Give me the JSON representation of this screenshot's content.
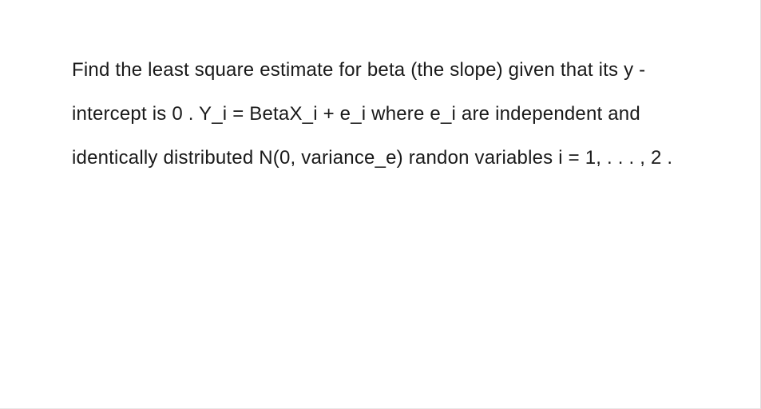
{
  "problem": {
    "text": "Find the least square estimate for beta (the slope) given that its y - intercept is 0 .  Y_i  =  BetaX_i  +  e_i where e_i are independent and identically distributed N(0, variance_e) randon variables i  =  1, . . . , 2 ."
  }
}
